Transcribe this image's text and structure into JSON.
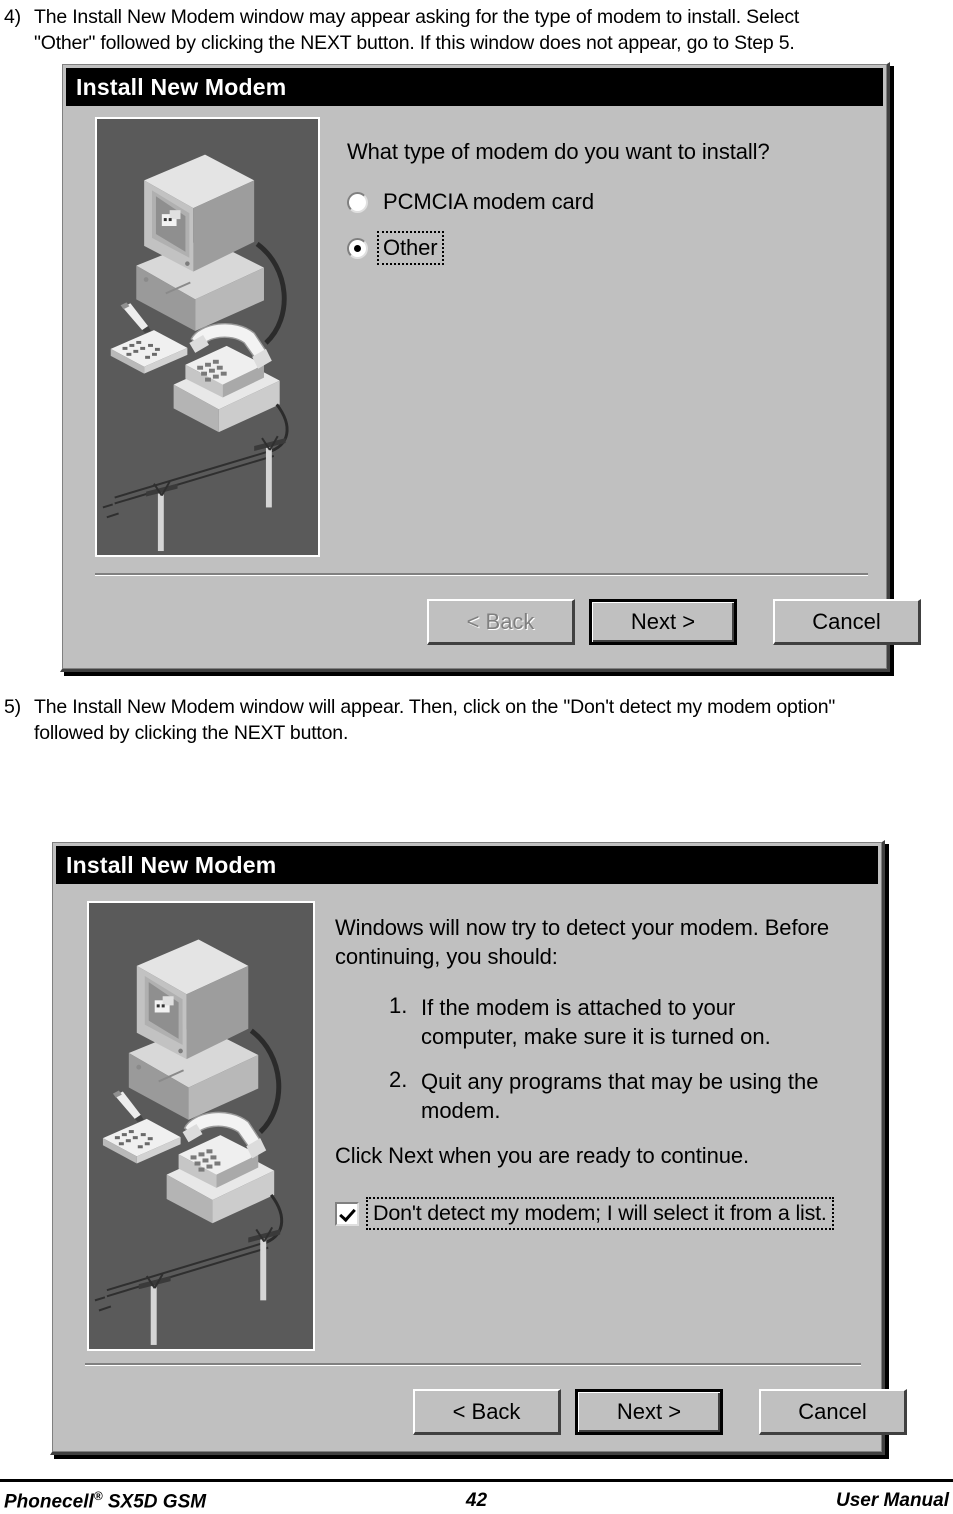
{
  "steps": [
    {
      "number": "4)",
      "lines": [
        "The Install New Modem window may appear asking for the type of modem to install. Select",
        "\"Other\" followed by clicking the NEXT button. If this window does not appear, go to Step 5."
      ]
    },
    {
      "number": "5)",
      "lines": [
        "The Install New Modem window will appear. Then, click on the \"Don't detect my modem option\"",
        "followed by clicking the NEXT button."
      ]
    }
  ],
  "dialog1": {
    "title": "Install New Modem",
    "illustration_name": "modem-setup-illustration",
    "question": "What type of modem do you want to install?",
    "options": [
      {
        "label": "PCMCIA modem card",
        "mnemonic": "P",
        "selected": false,
        "focused": false
      },
      {
        "label": "Other",
        "mnemonic": "O",
        "selected": true,
        "focused": true
      }
    ],
    "buttons": [
      {
        "label": "< Back",
        "mnemonic": "B",
        "state": "disabled",
        "default": false
      },
      {
        "label": "Next >",
        "mnemonic": "",
        "state": "enabled",
        "default": true
      },
      {
        "label": "Cancel",
        "mnemonic": "",
        "state": "enabled",
        "default": false
      }
    ]
  },
  "dialog2": {
    "title": "Install New Modem",
    "illustration_name": "modem-setup-illustration",
    "intro_lines": [
      "Windows will now try to detect your modem.  Before",
      "continuing, you should:"
    ],
    "list": [
      {
        "number": "1.",
        "lines": [
          "If the modem is attached to your",
          "computer, make sure it is turned on."
        ]
      },
      {
        "number": "2.",
        "lines": [
          "Quit any programs that may be using the",
          "modem."
        ]
      }
    ],
    "outro": "Click Next when you are ready to continue.",
    "checkbox": {
      "label": "Don't detect my modem; I will select it from a list.",
      "mnemonic": "D",
      "checked": true,
      "focused": true
    },
    "buttons": [
      {
        "label": "< Back",
        "mnemonic": "B",
        "state": "enabled",
        "default": false
      },
      {
        "label": "Next >",
        "mnemonic": "",
        "state": "enabled",
        "default": true
      },
      {
        "label": "Cancel",
        "mnemonic": "",
        "state": "enabled",
        "default": false
      }
    ]
  },
  "footer": {
    "left_pre": "Phonecell",
    "left_reg": "®",
    "left_post": " SX5D GSM",
    "page_number": "42",
    "right": "User Manual"
  },
  "colors": {
    "dialog_face": "#c0c0c0",
    "titlebar": "#000000",
    "titlebar_text": "#ffffff",
    "illustration_bg": "#5a5a5a",
    "disabled_text": "#808080"
  }
}
